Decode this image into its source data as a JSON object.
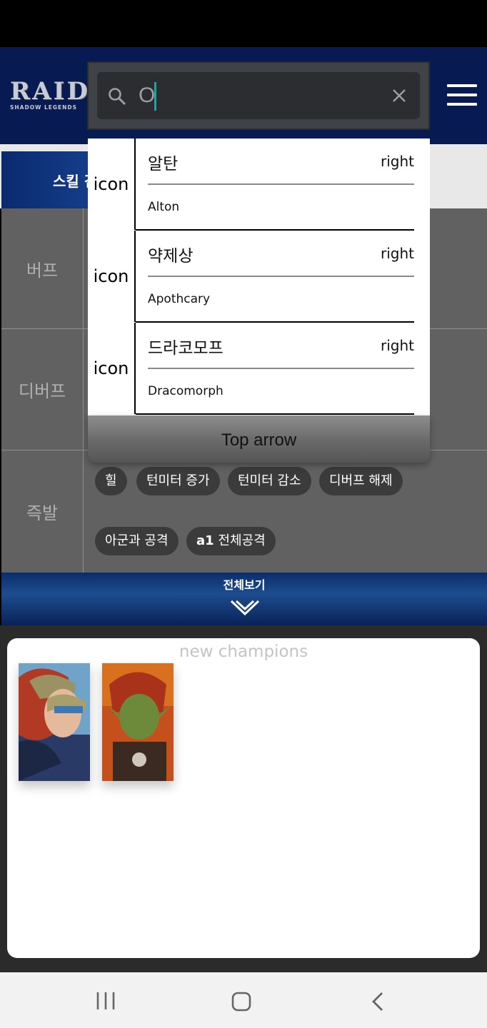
{
  "header": {
    "logo_main": "RAID",
    "logo_sub": "SHADOW LEGENDS"
  },
  "tabs": {
    "skill_label": "스킬 검색"
  },
  "search": {
    "value": "O",
    "caret_color": "#1fa59c"
  },
  "suggestions": [
    {
      "icon": "icon",
      "name": "알탄",
      "tag": "right",
      "en": "Alton"
    },
    {
      "icon": "icon",
      "name": "약제상",
      "tag": "right",
      "en": "Apothcary"
    },
    {
      "icon": "icon",
      "name": "드라코모프",
      "tag": "right",
      "en": "Dracomorph"
    }
  ],
  "top_arrow_label": "Top arrow",
  "filters": {
    "buff_label": "버프",
    "debuff_label": "디버프",
    "instant_label": "즉발",
    "instant_chips": [
      "힐",
      "턴미터 증가",
      "턴미터 감소",
      "디버프 해제",
      "아군과 공격"
    ],
    "instant_chip_a1_prefix": "a1",
    "instant_chip_a1_text": "전체공격"
  },
  "view_all_label": "전체보기",
  "champions": {
    "title": "new champions",
    "cards": [
      "champion-portrait-valkyrie",
      "champion-portrait-orc-warrior"
    ]
  },
  "colors": {
    "header_bg": "#071a52",
    "filter_bg": "#616161",
    "chip_bg": "#3b3b3b"
  }
}
